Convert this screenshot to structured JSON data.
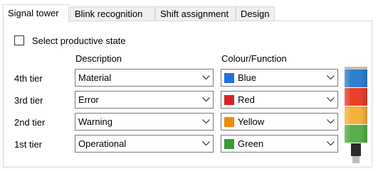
{
  "tabs": [
    {
      "label": "Signal tower",
      "active": true
    },
    {
      "label": "Blink recognition",
      "active": false
    },
    {
      "label": "Shift assignment",
      "active": false
    },
    {
      "label": "Design",
      "active": false
    }
  ],
  "checkbox": {
    "label": "Select productive state",
    "checked": false
  },
  "columns": {
    "description": "Description",
    "colour": "Colour/Function"
  },
  "tiers": [
    {
      "label": "4th tier",
      "description": "Material",
      "colour": "Blue",
      "swatch": "#1e6fe0"
    },
    {
      "label": "3rd tier",
      "description": "Error",
      "colour": "Red",
      "swatch": "#d6232b"
    },
    {
      "label": "2nd tier",
      "description": "Warning",
      "colour": "Yellow",
      "swatch": "#f08a0c"
    },
    {
      "label": "1st tier",
      "description": "Operational",
      "colour": "Green",
      "swatch": "#3a9a3a"
    }
  ],
  "tower": {
    "colors": [
      "#2f7fd0",
      "#e8402a",
      "#f4b23c",
      "#55b046"
    ],
    "cap": "#bfbfbf"
  }
}
